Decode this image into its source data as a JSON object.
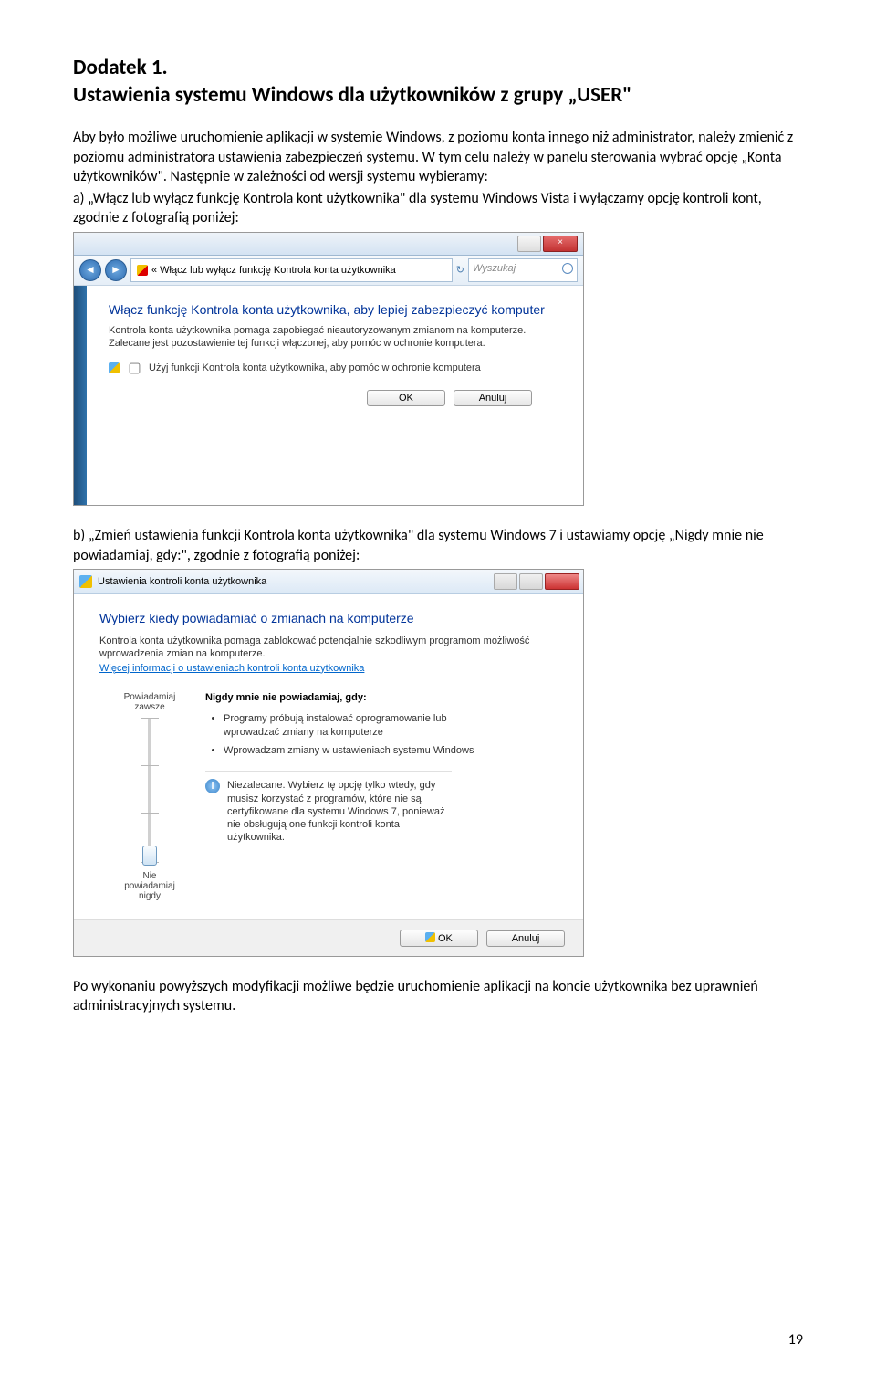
{
  "doc": {
    "title1": "Dodatek 1.",
    "title2": "Ustawienia systemu Windows dla użytkowników z grupy „USER\"",
    "para1": "Aby było możliwe uruchomienie aplikacji w systemie Windows, z poziomu konta innego niż administrator, należy zmienić z poziomu administratora ustawienia zabezpieczeń systemu. W tym celu należy w panelu sterowania wybrać opcję „Konta użytkowników\". Następnie w zależności od wersji systemu wybieramy:",
    "para_a": "a) „Włącz lub wyłącz funkcję Kontrola kont użytkownika\" dla systemu Windows Vista i wyłączamy opcję kontroli kont, zgodnie z fotografią poniżej:",
    "para_b": "b) „Zmień ustawienia funkcji Kontrola konta użytkownika\" dla systemu Windows 7 i ustawiamy opcję „Nigdy mnie nie powiadamiaj, gdy:\", zgodnie z fotografią poniżej:",
    "para_end": "Po wykonaniu powyższych modyfikacji możliwe będzie uruchomienie aplikacji na koncie użytkownika bez uprawnień administracyjnych systemu.",
    "page_number": "19"
  },
  "shot1": {
    "breadcrumb": "«  Włącz lub wyłącz funkcję Kontrola konta użytkownika",
    "search_placeholder": "Wyszukaj",
    "heading": "Włącz funkcję Kontrola konta użytkownika, aby lepiej zabezpieczyć komputer",
    "desc": "Kontrola konta użytkownika pomaga zapobiegać nieautoryzowanym zmianom na komputerze. Zalecane jest pozostawienie tej funkcji włączonej, aby pomóc w ochronie komputera.",
    "check_label": "Użyj funkcji Kontrola konta użytkownika, aby pomóc w ochronie komputera",
    "ok": "OK",
    "cancel": "Anuluj"
  },
  "shot2": {
    "titlebar": "Ustawienia kontroli konta użytkownika",
    "heading": "Wybierz kiedy powiadamiać o zmianach na komputerze",
    "desc": "Kontrola konta użytkownika pomaga zablokować potencjalnie szkodliwym programom możliwość wprowadzenia zmian na komputerze.",
    "link": "Więcej informacji o ustawieniach kontroli konta użytkownika",
    "always": "Powiadamiaj zawsze",
    "never_heading": "Nigdy mnie nie powiadamiaj, gdy:",
    "bullet1": "Programy próbują instalować oprogramowanie lub wprowadzać zmiany na komputerze",
    "bullet2": "Wprowadzam zmiany w ustawieniach systemu Windows",
    "warn": "Niezalecane. Wybierz tę opcję tylko wtedy, gdy musisz korzystać z programów, które nie są certyfikowane dla systemu Windows 7, ponieważ nie obsługują one funkcji kontroli konta użytkownika.",
    "never_bottom": "Nie powiadamiaj nigdy",
    "ok": "OK",
    "cancel": "Anuluj"
  }
}
